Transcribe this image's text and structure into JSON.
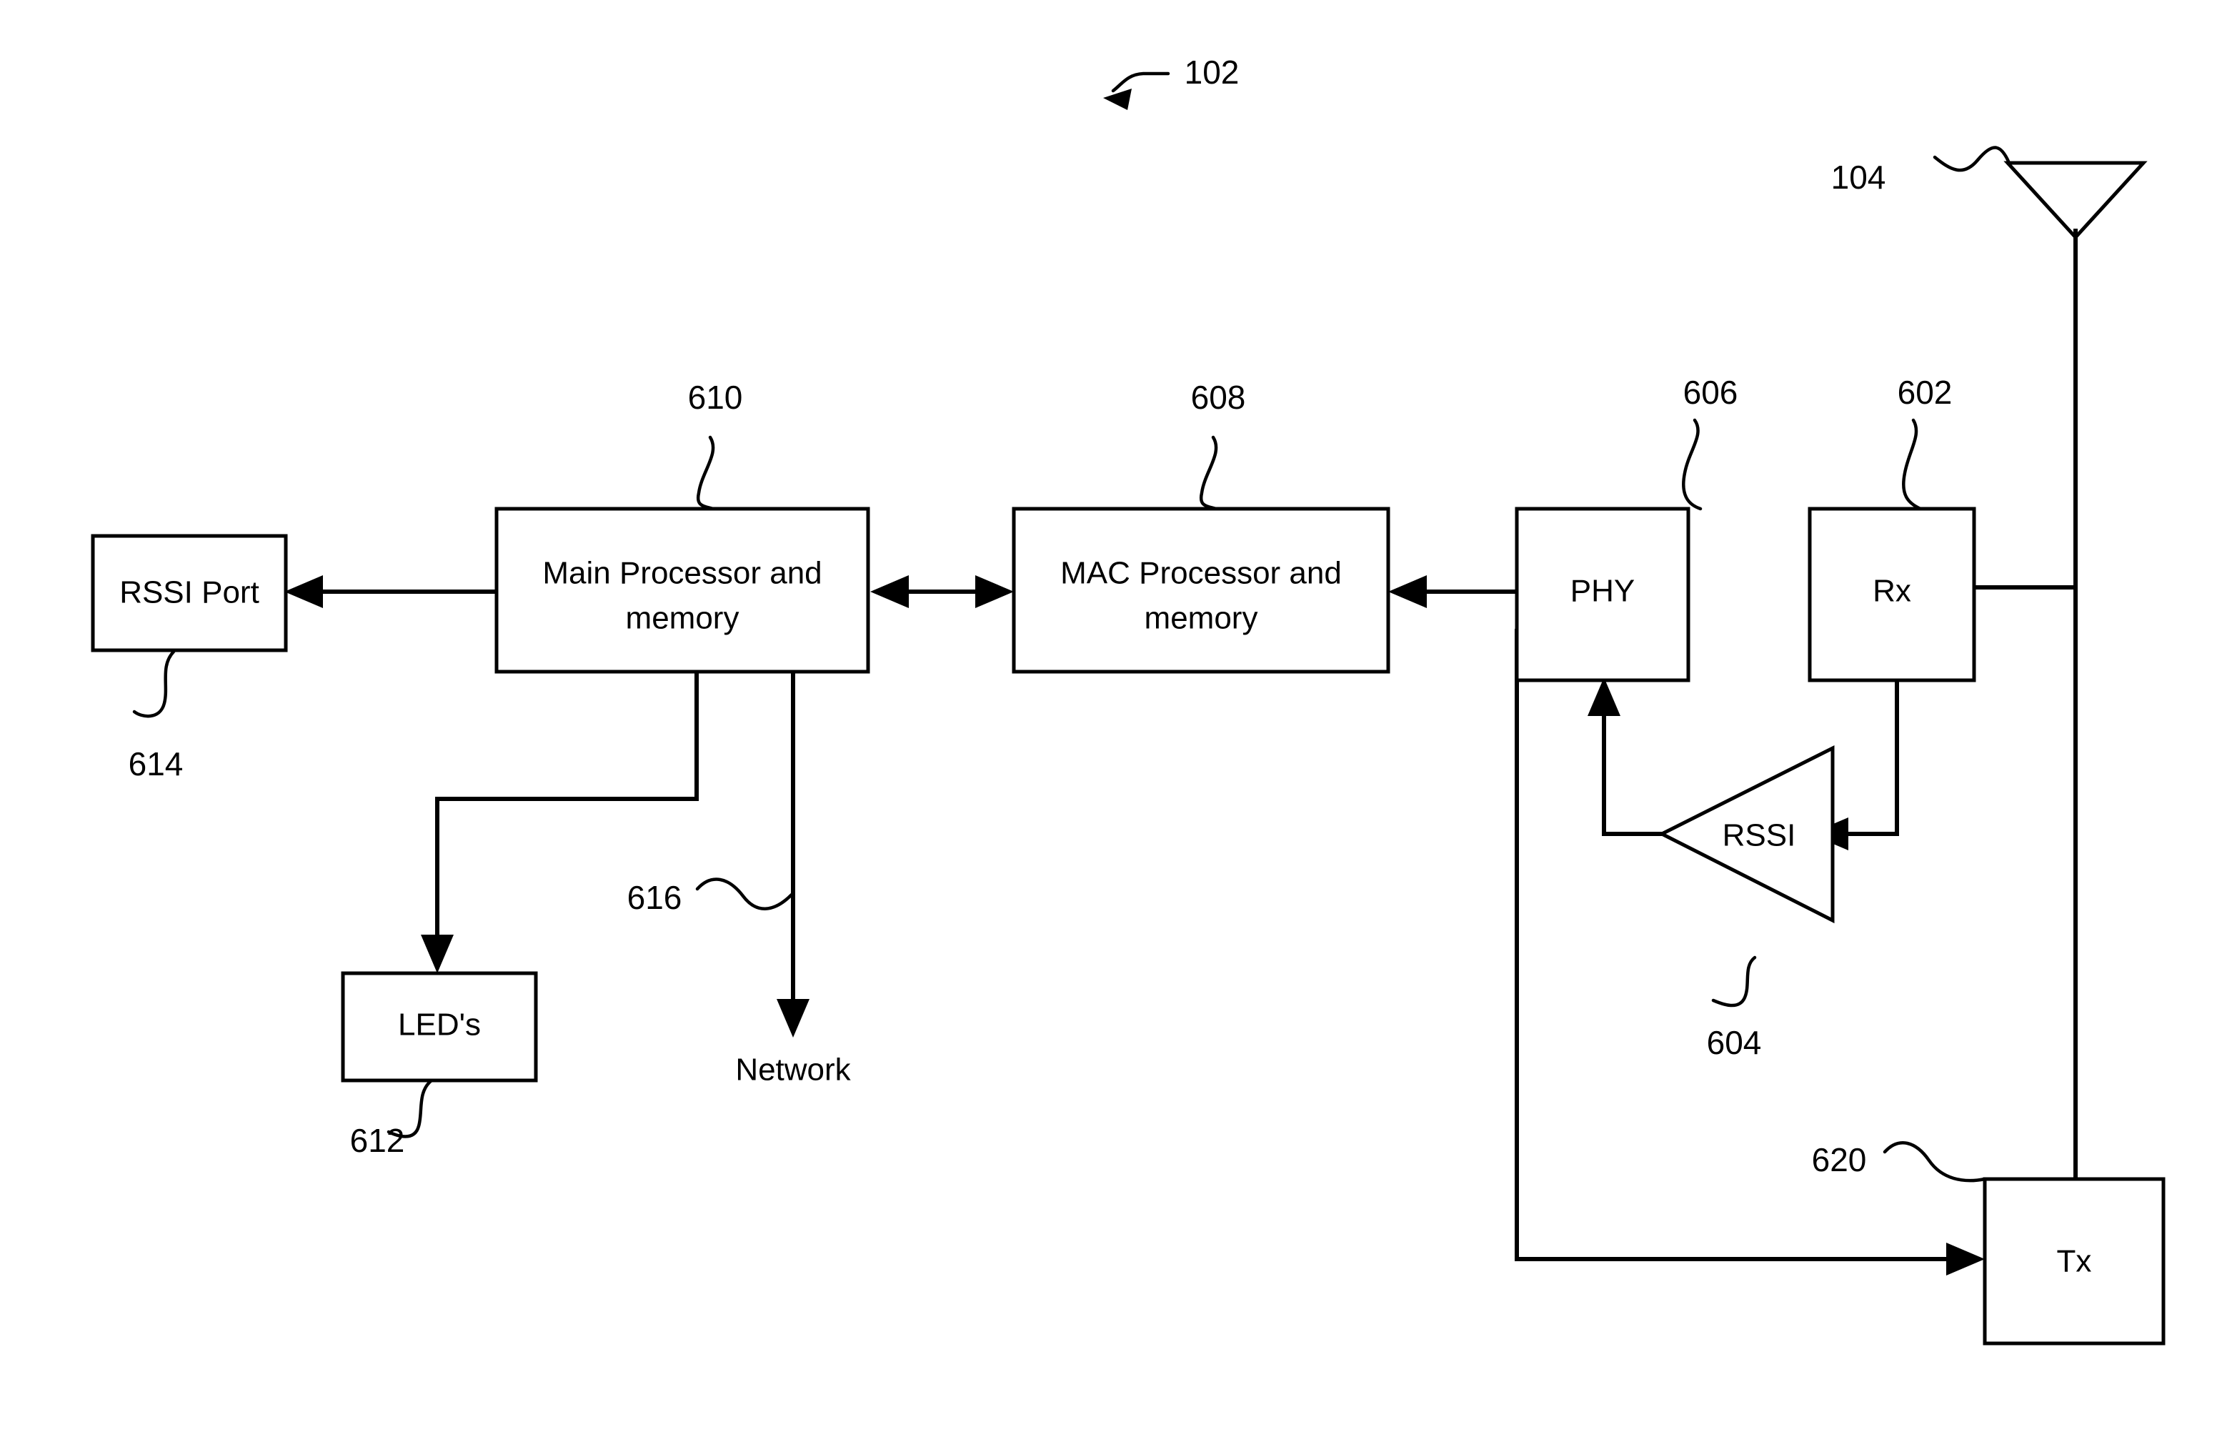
{
  "figure": {
    "type": "block-diagram",
    "title_reference": "102",
    "blocks": [
      {
        "id": "rssi-port",
        "label": "RSSI Port",
        "ref": "614"
      },
      {
        "id": "main-processor",
        "label_line1": "Main Processor and",
        "label_line2": "memory",
        "ref": "610"
      },
      {
        "id": "mac-processor",
        "label_line1": "MAC Processor and",
        "label_line2": "memory",
        "ref": "608"
      },
      {
        "id": "phy",
        "label": "PHY",
        "ref": "606"
      },
      {
        "id": "rx",
        "label": "Rx",
        "ref": "602"
      },
      {
        "id": "tx",
        "label": "Tx",
        "ref": "620"
      },
      {
        "id": "leds",
        "label": "LED's",
        "ref": "612"
      },
      {
        "id": "rssi-amp",
        "label": "RSSI",
        "ref": "604"
      }
    ],
    "endpoints": [
      {
        "id": "network",
        "label": "Network",
        "ref": "616"
      },
      {
        "id": "antenna",
        "label": "",
        "ref": "104"
      }
    ],
    "reference_numerals": {
      "system": "102",
      "antenna": "104",
      "rx": "602",
      "rssi_amp": "604",
      "phy": "606",
      "mac_processor": "608",
      "main_processor": "610",
      "leds": "612",
      "rssi_port": "614",
      "network": "616",
      "tx": "620"
    },
    "labels": {
      "rssi_port": "RSSI Port",
      "main_processor_line1": "Main Processor and",
      "main_processor_line2": "memory",
      "mac_processor_line1": "MAC Processor and",
      "mac_processor_line2": "memory",
      "phy": "PHY",
      "rx": "Rx",
      "tx": "Tx",
      "leds": "LED's",
      "rssi_amp": "RSSI",
      "network": "Network"
    },
    "colors": {
      "stroke": "#000000",
      "background": "#ffffff"
    }
  }
}
